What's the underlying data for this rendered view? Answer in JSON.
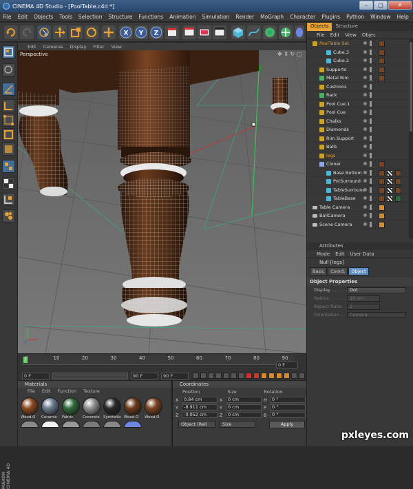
{
  "window": {
    "title": "CINEMA 4D Studio - [PoolTable.c4d *]"
  },
  "menubar": [
    "File",
    "Edit",
    "Objects",
    "Tools",
    "Selection",
    "Structure",
    "Functions",
    "Animation",
    "Simulation",
    "Render",
    "MoGraph",
    "Character",
    "Plugins",
    "Python",
    "Window",
    "Help"
  ],
  "viewport": {
    "menu": [
      "Edit",
      "Cameras",
      "Display",
      "Filter",
      "View"
    ],
    "label": "Perspective"
  },
  "timeline": {
    "ticks": [
      "0",
      "10",
      "20",
      "30",
      "40",
      "50",
      "60",
      "70",
      "80",
      "90"
    ],
    "current_frame": "0 F",
    "start_frame": "0 F",
    "end_frame": "90 F",
    "max_frame": "90 F"
  },
  "object_manager": {
    "tabs": [
      "Objects",
      "Structure"
    ],
    "menu": [
      "File",
      "Edit",
      "View",
      "Objec"
    ],
    "objects": [
      {
        "name": "PoolTable Set",
        "indent": 0,
        "color": "#e8a233",
        "icon": "null-icon"
      },
      {
        "name": "Cube.3",
        "indent": 2,
        "color": "#e0e0e0",
        "icon": "cube-icon"
      },
      {
        "name": "Cube.2",
        "indent": 2,
        "color": "#e0e0e0",
        "icon": "cube-icon"
      },
      {
        "name": "Supports",
        "indent": 1,
        "color": "#e0e0e0",
        "icon": "null-icon"
      },
      {
        "name": "Metal Rim",
        "indent": 1,
        "color": "#e0e0e0",
        "icon": "object-icon"
      },
      {
        "name": "Cushions",
        "indent": 1,
        "color": "#e0e0e0",
        "icon": "null-icon"
      },
      {
        "name": "Rack",
        "indent": 1,
        "color": "#e0e0e0",
        "icon": "object-icon"
      },
      {
        "name": "Pool Cue.1",
        "indent": 1,
        "color": "#e0e0e0",
        "icon": "null-icon"
      },
      {
        "name": "Pool Cue",
        "indent": 1,
        "color": "#e0e0e0",
        "icon": "null-icon"
      },
      {
        "name": "Chalks",
        "indent": 1,
        "color": "#e0e0e0",
        "icon": "null-icon"
      },
      {
        "name": "Diamonds",
        "indent": 1,
        "color": "#e0e0e0",
        "icon": "null-icon"
      },
      {
        "name": "Rim Support",
        "indent": 1,
        "color": "#e0e0e0",
        "icon": "null-icon"
      },
      {
        "name": "Balls",
        "indent": 1,
        "color": "#e0e0e0",
        "icon": "null-icon"
      },
      {
        "name": "legs",
        "indent": 1,
        "color": "#e8a233",
        "icon": "null-icon"
      },
      {
        "name": "Cloner",
        "indent": 1,
        "color": "#e0e0e0",
        "icon": "cloner-icon"
      },
      {
        "name": "Base Bottom",
        "indent": 2,
        "color": "#e0e0e0",
        "icon": "lathe-icon"
      },
      {
        "name": "PotSurround",
        "indent": 2,
        "color": "#e0e0e0",
        "icon": "lathe-icon"
      },
      {
        "name": "TableSurround",
        "indent": 2,
        "color": "#e0e0e0",
        "icon": "lathe-icon"
      },
      {
        "name": "TableBase",
        "indent": 2,
        "color": "#e0e0e0",
        "icon": "lathe-icon"
      },
      {
        "name": "Table Camera",
        "indent": 0,
        "color": "#e0e0e0",
        "icon": "camera-icon"
      },
      {
        "name": "BallCamera",
        "indent": 0,
        "color": "#e0e0e0",
        "icon": "camera-icon"
      },
      {
        "name": "Scene Camera",
        "indent": 0,
        "color": "#e0e0e0",
        "icon": "camera-icon"
      }
    ]
  },
  "attributes": {
    "tab": "Attributes",
    "menu": [
      "Mode",
      "Edit",
      "User Data"
    ],
    "object_label": "Null [legs]",
    "tabs": [
      "Basic",
      "Coord.",
      "Object"
    ],
    "active_tab": "Object",
    "section": "Object Properties",
    "props": [
      {
        "label": "Display . . . . . .",
        "value": "Dot",
        "enabled": true
      },
      {
        "label": "Radius . . . . . .",
        "value": "10 cm",
        "enabled": false
      },
      {
        "label": "Aspect Ratio",
        "value": "1",
        "enabled": false
      },
      {
        "label": "Orientation . . .",
        "value": "Camera",
        "enabled": false
      }
    ]
  },
  "materials": {
    "title": "Materials",
    "menu": [
      "File",
      "Edit",
      "Function",
      "Texture"
    ],
    "items": [
      {
        "name": "Wood.O",
        "color": "#8a4a22"
      },
      {
        "name": "Ceramic",
        "color": "#6a7a8c"
      },
      {
        "name": "Fabric",
        "color": "#2f6a3a"
      },
      {
        "name": "Concrete",
        "color": "#8f8f8f"
      },
      {
        "name": "Synthetic",
        "color": "#2a2a2a"
      },
      {
        "name": "Wood.O",
        "color": "#6b3a1a"
      },
      {
        "name": "Wood.O",
        "color": "#7a4420"
      }
    ]
  },
  "coordinates": {
    "title": "Coordinates",
    "headers": [
      "Position",
      "Size",
      "Rotation"
    ],
    "rows": [
      {
        "axis": "X",
        "pos": "0.84 cm",
        "size_axis": "X",
        "size": "0 cm",
        "rot_axis": "H",
        "rot": "0 °"
      },
      {
        "axis": "Y",
        "pos": "-8.911 cm",
        "size_axis": "Y",
        "size": "0 cm",
        "rot_axis": "P",
        "rot": "0 °"
      },
      {
        "axis": "Z",
        "pos": "-0.052 cm",
        "size_axis": "Z",
        "size": "0 cm",
        "rot_axis": "B",
        "rot": "0 °"
      }
    ],
    "mode": "Object (Rel)",
    "size_mode": "Size",
    "apply_label": "Apply"
  },
  "branding": {
    "maxon": "MAXON CINEMA 4D",
    "watermark": "pxleyes.com"
  }
}
